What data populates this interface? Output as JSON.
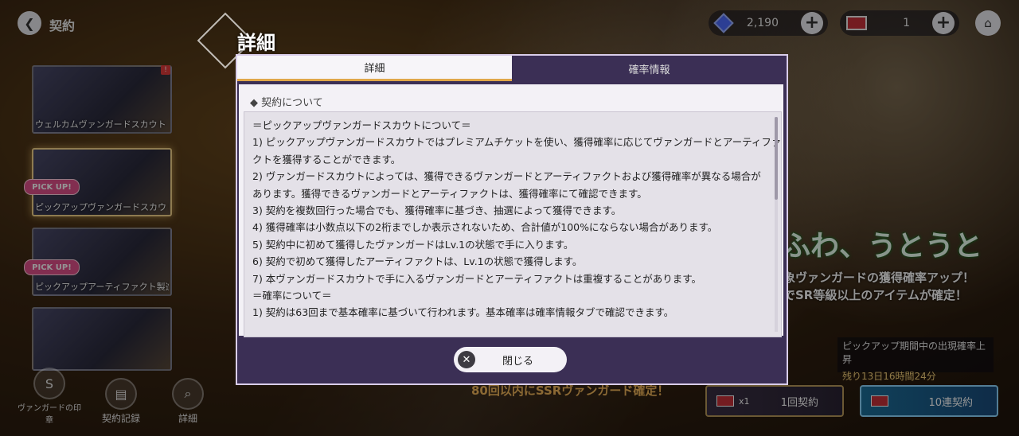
{
  "top": {
    "title": "契約",
    "currency_gems": "2,190",
    "currency_tickets": "1"
  },
  "banners": [
    {
      "label": "ウェルカムヴァンガードスカウト",
      "pickup": ""
    },
    {
      "label": "ピックアップヴァンガードスカウト",
      "pickup": "PICK UP!"
    },
    {
      "label": "ピックアップアーティファクト製造",
      "pickup": "PICK UP!"
    },
    {
      "label": "",
      "pickup": ""
    }
  ],
  "bottom_nav": [
    {
      "label": "ヴァンガードの印章"
    },
    {
      "label": "契約記録"
    },
    {
      "label": "詳細"
    }
  ],
  "background": {
    "hero_text": "ふわ、うとうと",
    "hero_sub1": "象ヴァンガードの獲得確率アップ！",
    "hero_sub2": "でSR等級以上のアイテムが確定！",
    "period_label": "ピックアップ期間中の出現確率上昇",
    "period_time": "残り13日16時間24分",
    "guarantee_text": "80回以内にSSRヴァンガード確定！",
    "pull1_count": "x1",
    "pull1_label": "1回契約",
    "pull10_label": "10連契約"
  },
  "modal": {
    "title": "詳細",
    "tabs": [
      {
        "label": "詳細"
      },
      {
        "label": "確率情報"
      }
    ],
    "section_heading": "◆ 契約について",
    "lines": [
      "＝ピックアップヴァンガードスカウトについて＝",
      "1) ピックアップヴァンガードスカウトではプレミアムチケットを使い、獲得確率に応じてヴァンガードとアーティファ",
      "クトを獲得することができます。",
      "2) ヴァンガードスカウトによっては、獲得できるヴァンガードとアーティファクトおよび獲得確率が異なる場合が",
      "あります。獲得できるヴァンガードとアーティファクトは、獲得確率にて確認できます。",
      "3) 契約を複数回行った場合でも、獲得確率に基づき、抽選によって獲得できます。",
      "4) 獲得確率は小数点以下の2桁までしか表示されないため、合計値が100%にならない場合があります。",
      "5) 契約中に初めて獲得したヴァンガードはLv.1の状態で手に入ります。",
      "6) 契約で初めて獲得したアーティファクトは、Lv.1の状態で獲得します。",
      "7) 本ヴァンガードスカウトで手に入るヴァンガードとアーティファクトは重複することがあります。",
      "",
      "＝確率について＝",
      "1) 契約は63回まで基本確率に基づいて行われます。基本確率は確率情報タブで確認できます。"
    ],
    "close_label": "閉じる"
  }
}
